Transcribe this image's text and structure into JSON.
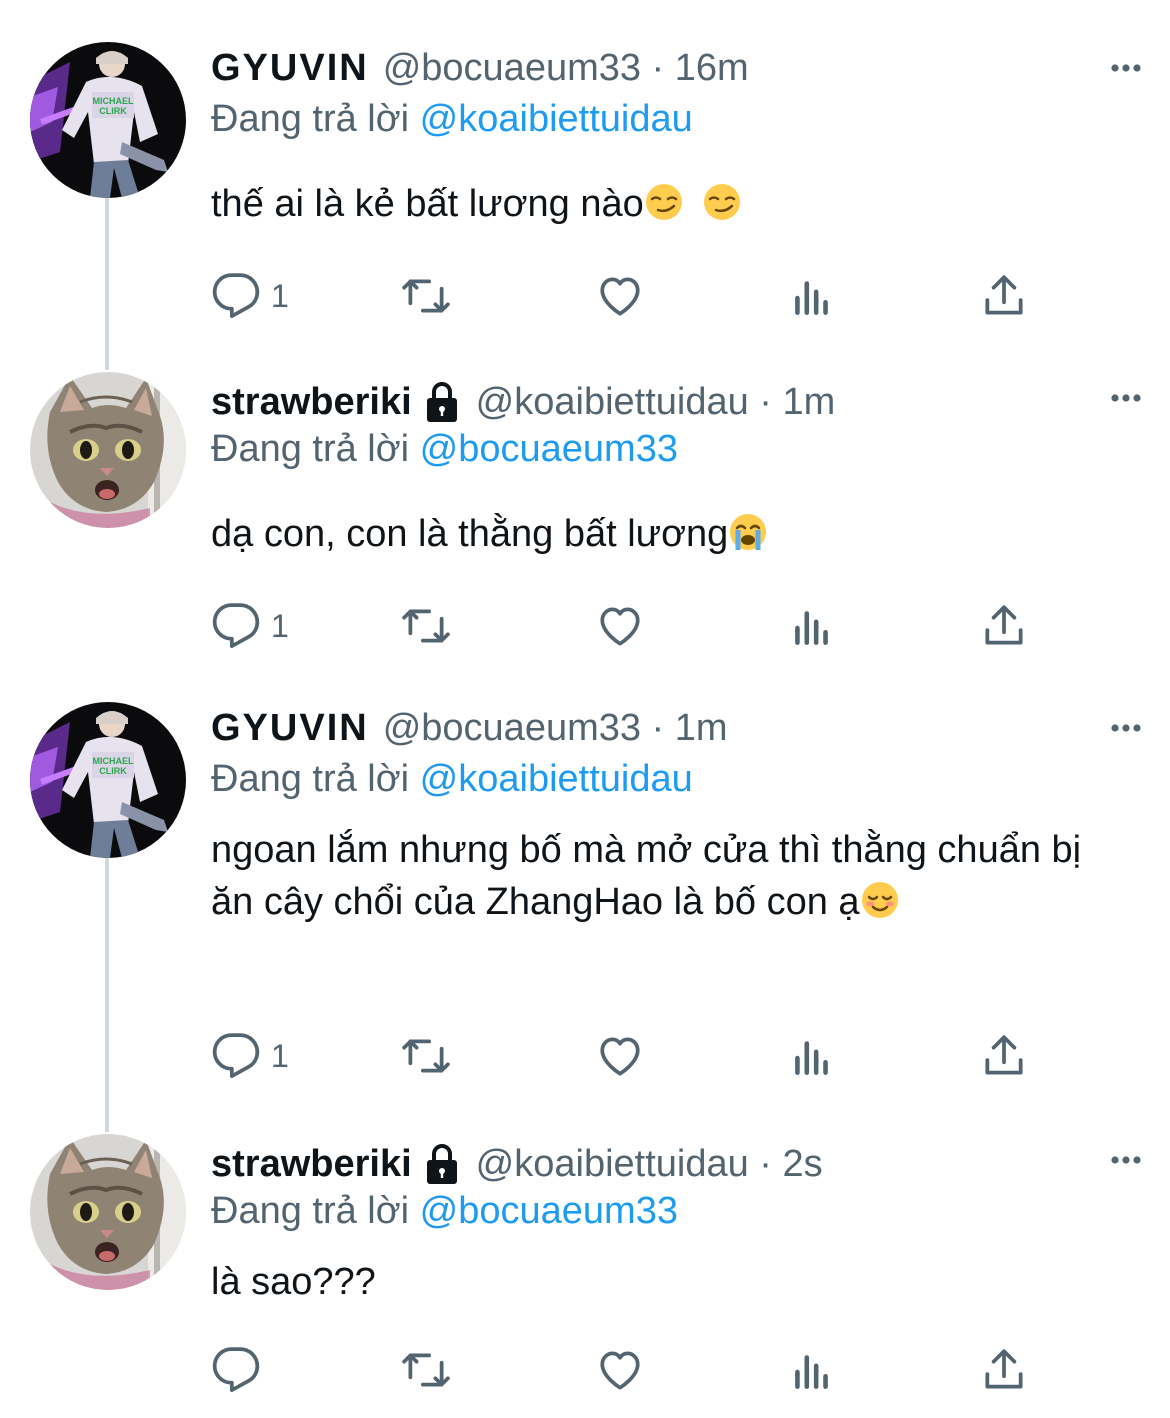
{
  "tweets": [
    {
      "name": "GYUVIN",
      "handle_time": "@bocuaeum33 · 16m",
      "reply_prefix": "Đang trả lời",
      "reply_to": "@koaibiettuidau",
      "text": "thế ai là kẻ bất lương nào",
      "emoji": "smirk-emoji",
      "emoji2": "smirk-emoji",
      "reply_count": "1",
      "avatar": "person-photo",
      "protected": false
    },
    {
      "name": "strawberiki",
      "handle_time": "@koaibiettuidau · 1m",
      "reply_prefix": "Đang trả lời",
      "reply_to": "@bocuaeum33",
      "text": "dạ con, con là thằng bất lương",
      "emoji": "crying-emoji",
      "reply_count": "1",
      "avatar": "cat-photo",
      "protected": true
    },
    {
      "name": "GYUVIN",
      "handle_time": "@bocuaeum33 · 1m",
      "reply_prefix": "Đang trả lời",
      "reply_to": "@koaibiettuidau",
      "text": "ngoan lắm nhưng bố mà mở cửa thì thằng chuẩn bị ăn cây chổi của ZhangHao là bố con ạ",
      "emoji": "smiling-blush-emoji",
      "reply_count": "1",
      "avatar": "person-photo",
      "protected": false
    },
    {
      "name": "strawberiki",
      "handle_time": "@koaibiettuidau · 2s",
      "reply_prefix": "Đang trả lời",
      "reply_to": "@bocuaeum33",
      "text": "là sao???",
      "reply_count": "",
      "avatar": "cat-photo",
      "protected": true
    }
  ],
  "icons": {
    "reply": "reply-icon",
    "retweet": "retweet-icon",
    "like": "like-icon",
    "views": "views-icon",
    "share": "share-icon",
    "more": "more-icon",
    "lock": "lock-icon"
  },
  "colors": {
    "text": "#0f1419",
    "secondary": "#536471",
    "link": "#1d9bf0",
    "thread_line": "#cfd9de"
  }
}
